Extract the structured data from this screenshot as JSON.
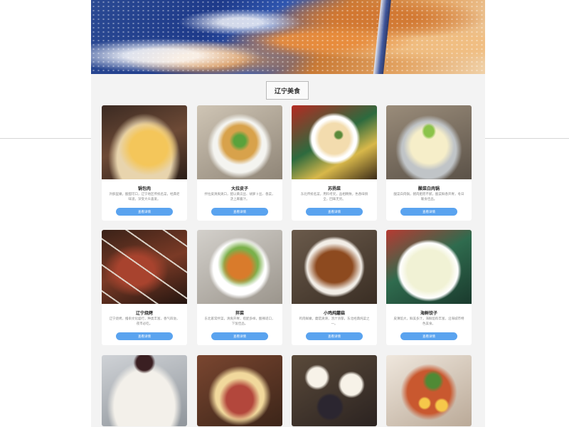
{
  "section": {
    "title": "辽宁美食"
  },
  "detail_button_label": "查看详情",
  "dishes": [
    {
      "name": "锅包肉",
      "desc": "外酥里嫩，酸甜可口，辽宁地区传统名菜，经典老味道，深受大众喜爱。",
      "icon": "guobao-photo"
    },
    {
      "name": "大拉皮子",
      "desc": "拌拉皮清爽爽口，配以黄瓜丝、胡萝卜丝、香菜，浇上麻酱汁。",
      "icon": "salad-photo"
    },
    {
      "name": "苏扬菜",
      "desc": "东北传统名菜，用料考究，品相精致，色香味俱全，回味无穷。",
      "icon": "plate-photo"
    },
    {
      "name": "酸菜白肉锅",
      "desc": "酸菜白肉锅，猪肉肥而不腻，酸菜鲜香开胃，冬日暖身佳品。",
      "icon": "hotpot-photo"
    },
    {
      "name": "辽宁烧烤",
      "desc": "辽宁烧烤，撸串文化盛行，种类丰富，香气四溢，夜市必吃。",
      "icon": "bbq-photo"
    },
    {
      "name": "拌菜",
      "desc": "东北家常拌菜，清爽开胃，搭配多样，酸辣适口，下饭佳品。",
      "icon": "cold-dish-photo"
    },
    {
      "name": "小鸡炖蘑菇",
      "desc": "鸡肉鲜嫩，蘑菇爽滑，汤汁浓郁，东北经典炖菜之一。",
      "icon": "stew-photo"
    },
    {
      "name": "海鲜饺子",
      "desc": "皮薄馅大，鲜美多汁，海鲜馅料丰富，沿海城市特色美食。",
      "icon": "dumpling-photo"
    },
    {
      "name": "",
      "desc": "",
      "icon": "jiaozi-photo"
    },
    {
      "name": "",
      "desc": "",
      "icon": "sandwich-photo"
    },
    {
      "name": "",
      "desc": "",
      "icon": "eggs-photo"
    },
    {
      "name": "",
      "desc": "",
      "icon": "noodle-photo"
    }
  ]
}
